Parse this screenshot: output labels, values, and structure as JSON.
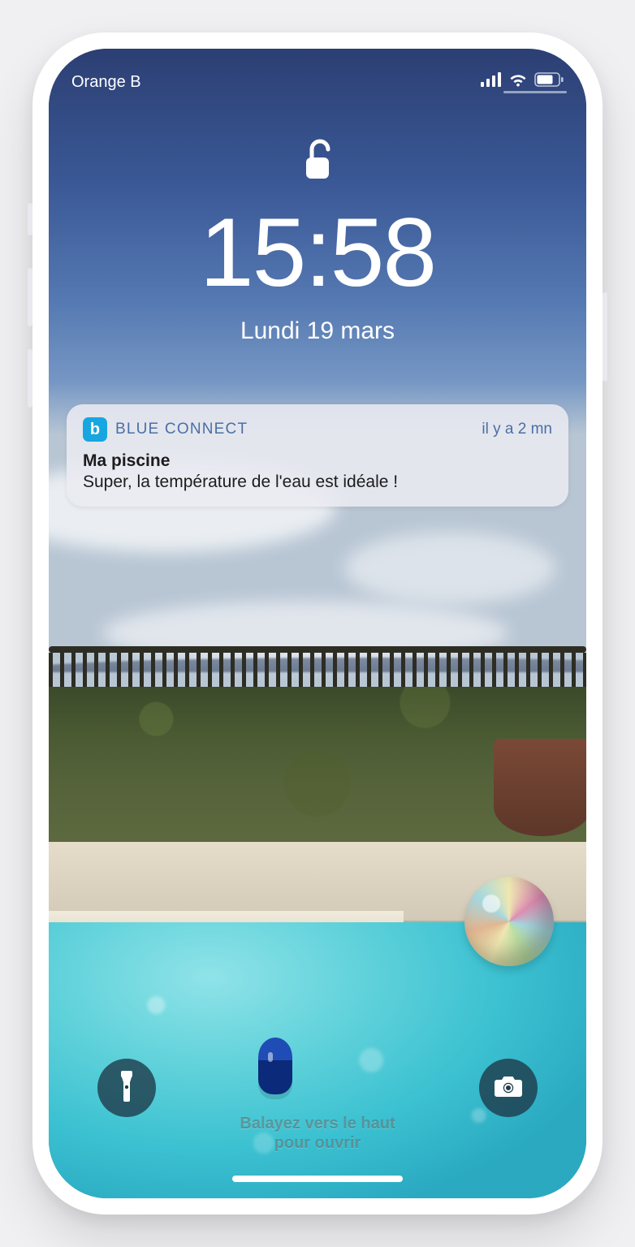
{
  "status": {
    "carrier": "Orange B"
  },
  "lock": {
    "time": "15:58",
    "date": "Lundi 19 mars"
  },
  "notification": {
    "app_icon_letter": "b",
    "app_name": "BLUE CONNECT",
    "timestamp": "il y a 2 mn",
    "title": "Ma piscine",
    "body": "Super, la température de l'eau est idéale !"
  },
  "hint": {
    "line1": "Balayez vers le haut",
    "line2": "pour ouvrir"
  }
}
